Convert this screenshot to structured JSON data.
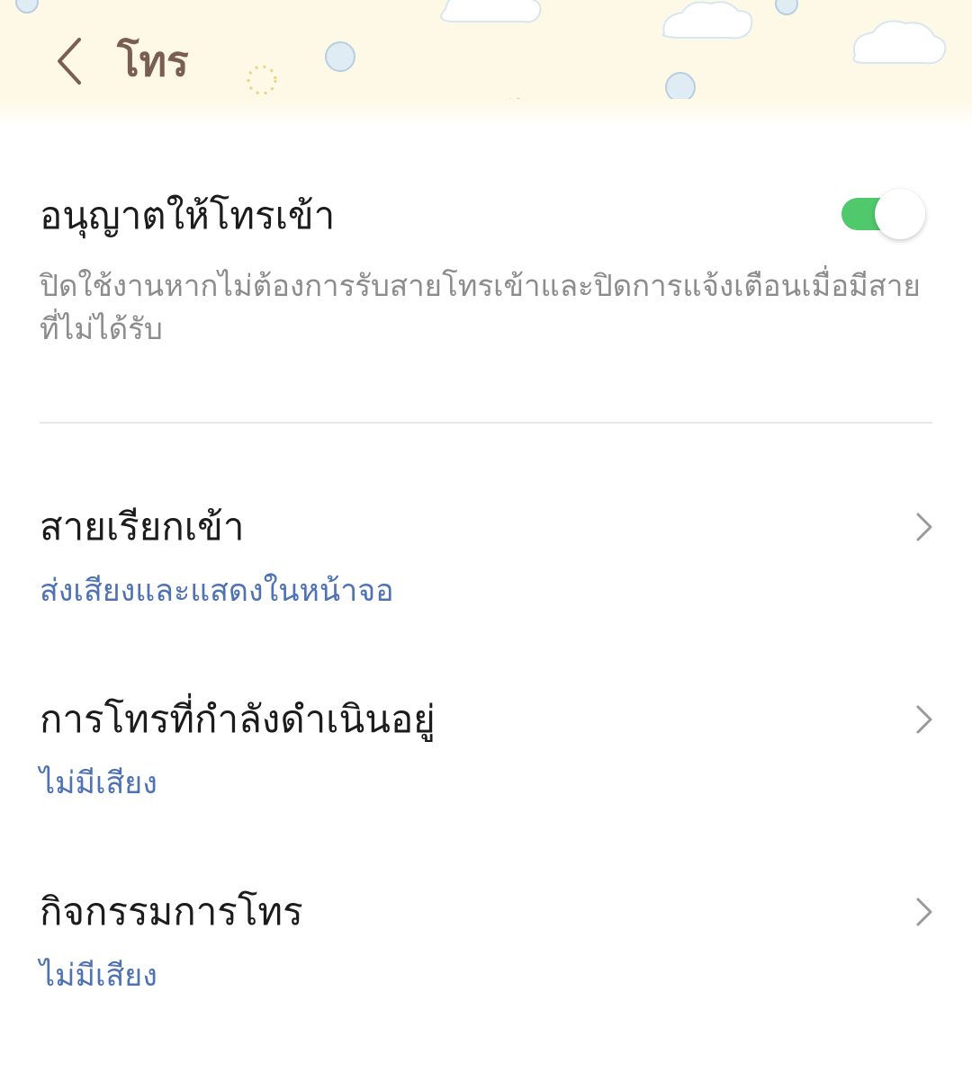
{
  "header": {
    "back_icon": "chevron-left-icon",
    "title": "โทร",
    "background_color": "#fdf9e6",
    "title_color": "#7a5f51"
  },
  "allow_calls": {
    "title": "อนุญาตให้โทรเข้า",
    "description": "ปิดใช้งานหากไม่ต้องการรับสายโทรเข้าและปิดการแจ้งเตือนเมื่อมีสายที่ไม่ได้รับ",
    "enabled": true,
    "toggle_color": "#4fc96c"
  },
  "settings": [
    {
      "title": "สายเรียกเข้า",
      "value": "ส่งเสียงและแสดงในหน้าจอ",
      "icon": "chevron-right-icon"
    },
    {
      "title": "การโทรที่กำลังดำเนินอยู่",
      "value": "ไม่มีเสียง",
      "icon": "chevron-right-icon"
    },
    {
      "title": "กิจกรรมการโทร",
      "value": "ไม่มีเสียง",
      "icon": "chevron-right-icon"
    }
  ],
  "colors": {
    "value_text": "#4e72b4",
    "primary_text": "#1c1c1c",
    "secondary_text": "#8c8c8c"
  }
}
